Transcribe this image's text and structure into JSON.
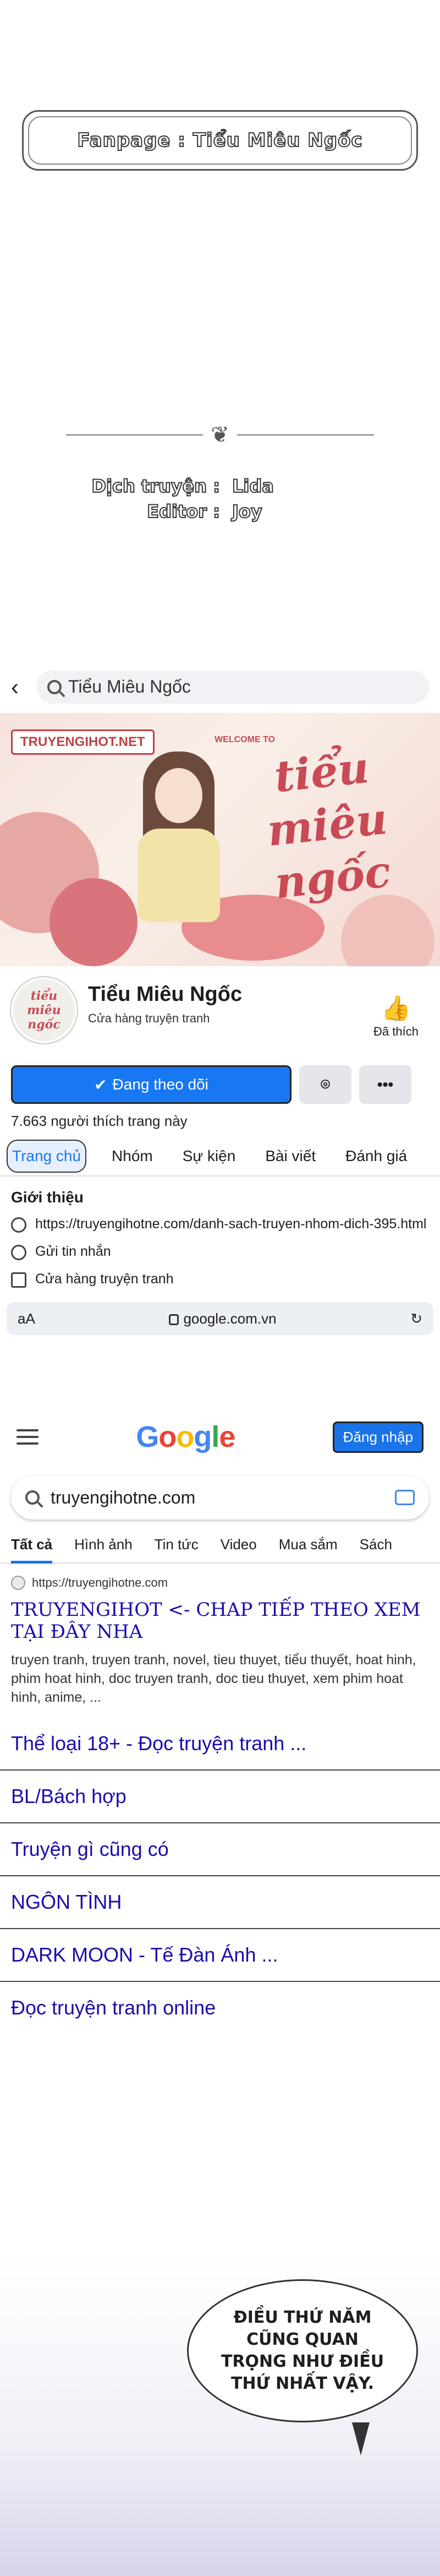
{
  "credits": {
    "fanpage": "Fanpage : Tiểu Miêu Ngốc",
    "rows": [
      {
        "key": "Dịch truyện :",
        "value": "Lida"
      },
      {
        "key": "Editor :",
        "value": "Joy"
      }
    ]
  },
  "facebook": {
    "search_text": "Tiểu Miêu Ngốc",
    "cover": {
      "brand": "TRUYENGIHOT.NET",
      "welcome": "WELCOME TO",
      "title": "tiểu miêu ngốc"
    },
    "avatar_text": "tiểu miêu ngốc",
    "page_name": "Tiểu Miêu Ngốc",
    "category": "Cửa hàng truyện tranh",
    "liked_label": "Đã thích",
    "follow_label": "Đang theo dõi",
    "more_label": "•••",
    "likes_count": "7.663 người thích trang này",
    "tabs": [
      "Trang chủ",
      "Nhóm",
      "Sự kiện",
      "Bài viết",
      "Đánh giá"
    ],
    "intro_title": "Giới thiệu",
    "intro_link": "https://truyengihotne.com/danh-sach-truyen-nhom-dich-395.html",
    "message_label": "Gửi tin nhắn",
    "shop_label": "Cửa hàng truyện tranh",
    "url_bar": {
      "left": "aA",
      "domain": "google.com.vn"
    }
  },
  "google": {
    "logo": "Google",
    "logo_colors": [
      "#4285f4",
      "#ea4335",
      "#fbbc05",
      "#4285f4",
      "#34a853",
      "#ea4335"
    ],
    "signin_label": "Đăng nhập",
    "query": "truyengihotne.com",
    "tabs": [
      "Tất cả",
      "Hình ảnh",
      "Tin tức",
      "Video",
      "Mua sắm",
      "Sách"
    ],
    "result": {
      "url": "https://truyengihotne.com",
      "title": "TRUYENGIHOT <- CHAP TIẾP THEO XEM TẠI ĐÂY NHA",
      "snippet": "truyen tranh, truyen tranh, novel, tieu thuyet, tiểu thuyết, hoat hinh, phim hoat hinh, doc truyen tranh, doc tieu thuyet, xem phim hoat hinh, anime, ..."
    },
    "links": [
      "Thể loại 18+ - Đọc truyện tranh ...",
      "BL/Bách hợp",
      "Truyện gì cũng có",
      "NGÔN TÌNH",
      "DARK MOON - Tế Đàn Ánh ...",
      "Đọc truyện tranh online"
    ]
  },
  "comic": {
    "bubble_text": "ĐIỀU THỨ NĂM CŨNG QUAN TRỌNG NHƯ ĐIỀU THỨ NHẤT VẬY."
  }
}
